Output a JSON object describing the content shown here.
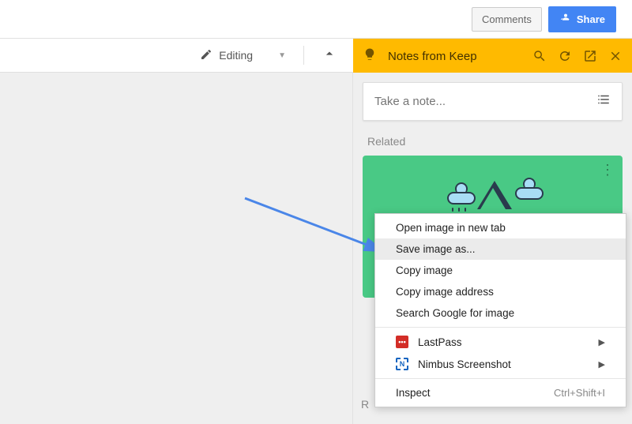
{
  "topbar": {
    "comments_label": "Comments",
    "share_label": "Share"
  },
  "subbar": {
    "editing_label": "Editing"
  },
  "keep": {
    "title": "Notes from Keep",
    "note_placeholder": "Take a note...",
    "related_label": "Related",
    "orphan_letter": "R"
  },
  "context_menu": {
    "items": [
      {
        "label": "Open image in new tab"
      },
      {
        "label": "Save image as...",
        "highlighted": true
      },
      {
        "label": "Copy image"
      },
      {
        "label": "Copy image address"
      },
      {
        "label": "Search Google for image"
      }
    ],
    "extensions": [
      {
        "label": "LastPass",
        "icon": "lastpass"
      },
      {
        "label": "Nimbus Screenshot",
        "icon": "nimbus"
      }
    ],
    "inspect": {
      "label": "Inspect",
      "shortcut": "Ctrl+Shift+I"
    }
  }
}
